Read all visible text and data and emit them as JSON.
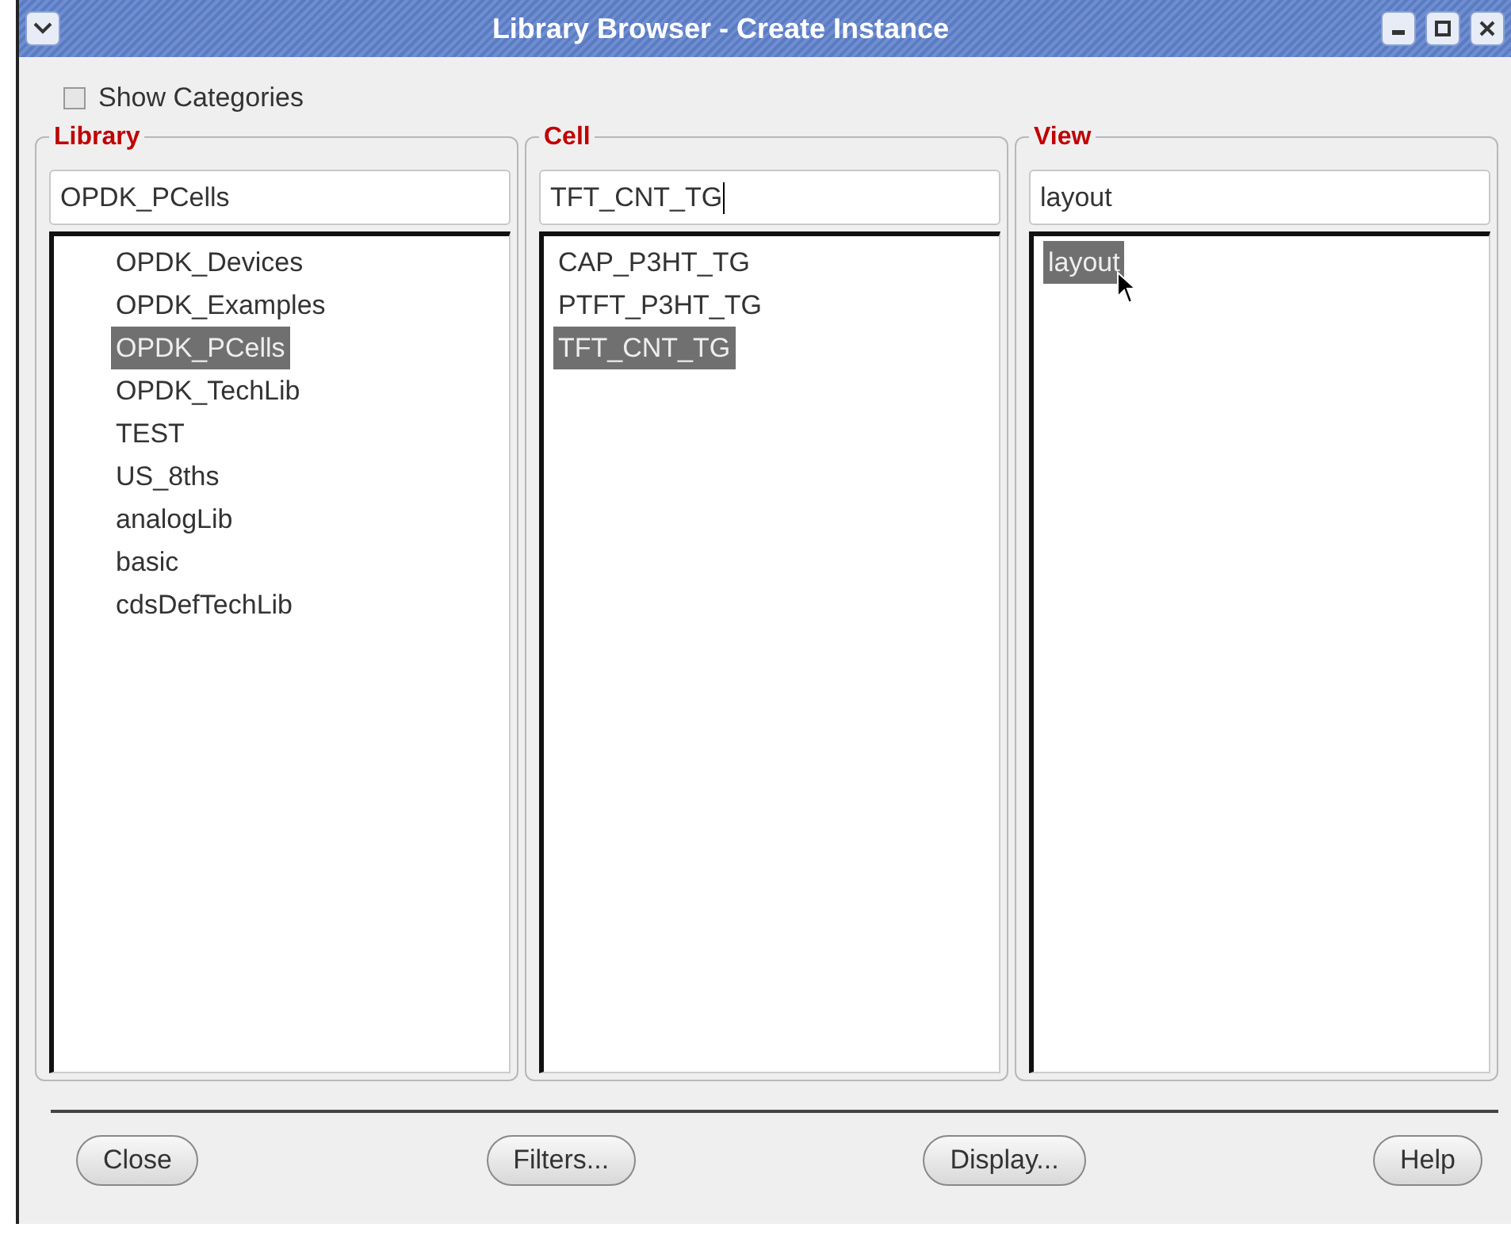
{
  "window": {
    "title": "Library Browser - Create Instance"
  },
  "show_categories": {
    "label": "Show Categories",
    "checked": false
  },
  "panels": [
    {
      "title": "Library",
      "value": "OPDK_PCells",
      "focused": false,
      "indented": true,
      "items": [
        {
          "label": "OPDK_Devices",
          "selected": false
        },
        {
          "label": "OPDK_Examples",
          "selected": false
        },
        {
          "label": "OPDK_PCells",
          "selected": true
        },
        {
          "label": "OPDK_TechLib",
          "selected": false
        },
        {
          "label": "TEST",
          "selected": false
        },
        {
          "label": "US_8ths",
          "selected": false
        },
        {
          "label": "analogLib",
          "selected": false
        },
        {
          "label": "basic",
          "selected": false
        },
        {
          "label": "cdsDefTechLib",
          "selected": false
        }
      ]
    },
    {
      "title": "Cell",
      "value": "TFT_CNT_TG",
      "focused": true,
      "indented": false,
      "items": [
        {
          "label": "CAP_P3HT_TG",
          "selected": false
        },
        {
          "label": "PTFT_P3HT_TG",
          "selected": false
        },
        {
          "label": "TFT_CNT_TG",
          "selected": true
        }
      ]
    },
    {
      "title": "View",
      "value": "layout",
      "focused": false,
      "indented": false,
      "pointer": true,
      "items": [
        {
          "label": "layout",
          "selected": true
        }
      ]
    }
  ],
  "buttons": [
    "Close",
    "Filters...",
    "Display...",
    "Help"
  ]
}
